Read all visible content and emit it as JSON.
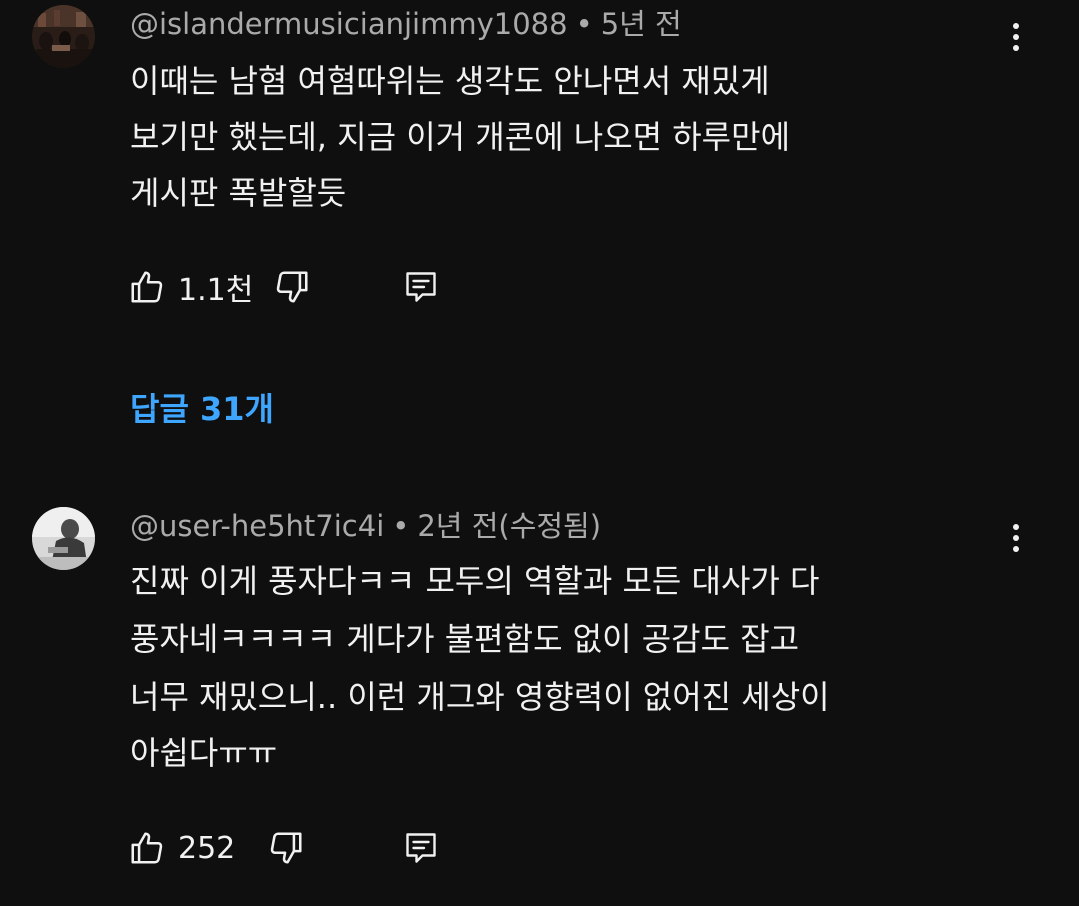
{
  "comments": [
    {
      "handle": "@islandermusicianjimmy1088",
      "separator": "•",
      "time": "5년 전",
      "lines": [
        "이때는 남혐 여혐따위는 생각도 안나면서 재밌게",
        "보기만 했는데, 지금 이거 개콘에 나오면 하루만에",
        "게시판 폭발할듯"
      ],
      "likes": "1.1천"
    },
    {
      "handle": "@user-he5ht7ic4i",
      "separator": "•",
      "time": "2년 전(수정됨)",
      "lines": [
        "진짜 이게 풍자다ㅋㅋ 모두의 역할과 모든 대사가 다",
        "풍자네ㅋㅋㅋㅋ 게다가 불편함도 없이 공감도 잡고",
        "너무 재밌으니.. 이런 개그와 영향력이 없어진 세상이",
        "아쉽다ㅠㅠ"
      ],
      "likes": "252"
    }
  ],
  "replies_label": "답글 31개",
  "icons": {
    "like": "thumbs-up-icon",
    "dislike": "thumbs-down-icon",
    "reply": "comment-icon",
    "more": "more-vertical-icon"
  },
  "colors": {
    "background": "#0f0f0f",
    "text": "#f1f1f1",
    "meta": "#aaaaaa",
    "link": "#3ea6ff"
  }
}
